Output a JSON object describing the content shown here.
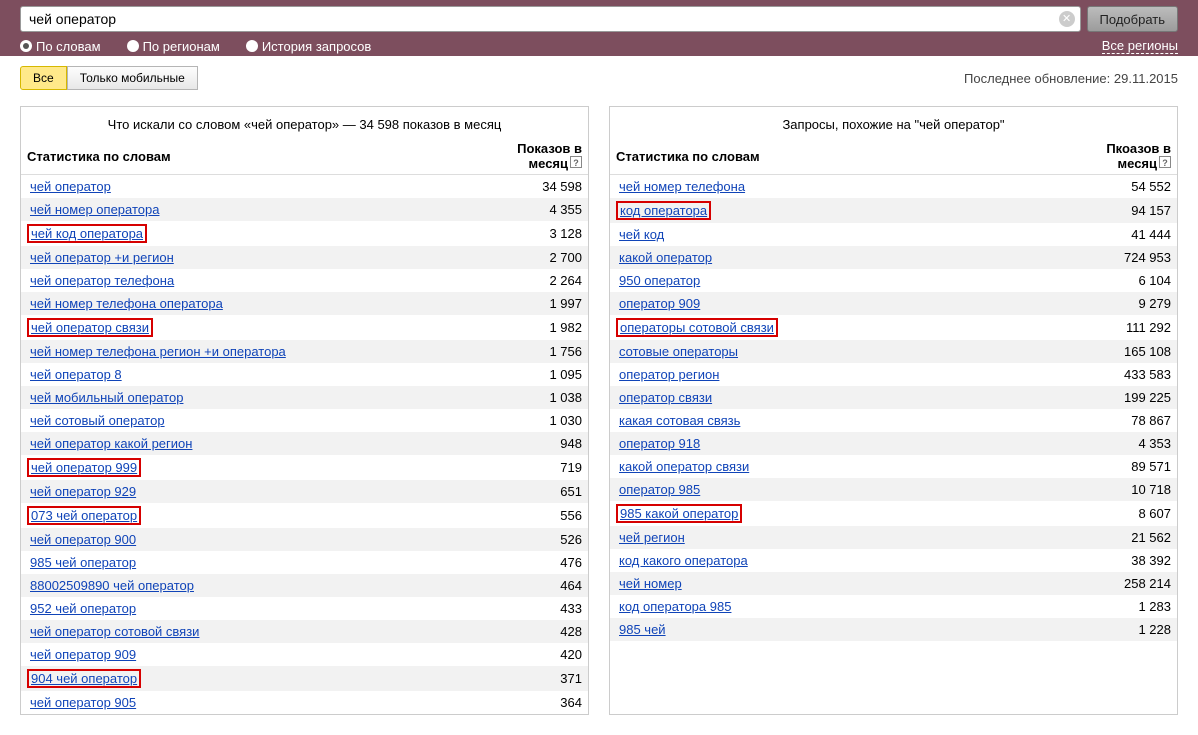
{
  "search": {
    "query": "чей оператор",
    "submit_label": "Подобрать"
  },
  "tabs_mode": {
    "by_words": "По словам",
    "by_regions": "По регионам",
    "history": "История запросов"
  },
  "region_link": "Все регионы",
  "device_tabs": {
    "all": "Все",
    "mobile": "Только мобильные"
  },
  "update_info": "Последнее обновление: 29.11.2015",
  "left_panel": {
    "title": "Что искали со словом «чей оператор» — 34 598 показов в месяц",
    "head_term": "Статистика по словам",
    "head_count": "Показов в месяц",
    "rows": [
      {
        "term": "чей оператор",
        "count": "34 598",
        "hl": false
      },
      {
        "term": "чей номер оператора",
        "count": "4 355",
        "hl": false
      },
      {
        "term": "чей код оператора",
        "count": "3 128",
        "hl": true
      },
      {
        "term": "чей оператор +и регион",
        "count": "2 700",
        "hl": false
      },
      {
        "term": "чей оператор телефона",
        "count": "2 264",
        "hl": false
      },
      {
        "term": "чей номер телефона оператора",
        "count": "1 997",
        "hl": false
      },
      {
        "term": "чей оператор связи",
        "count": "1 982",
        "hl": true
      },
      {
        "term": "чей номер телефона регион +и оператора",
        "count": "1 756",
        "hl": false
      },
      {
        "term": "чей оператор 8",
        "count": "1 095",
        "hl": false
      },
      {
        "term": "чей мобильный оператор",
        "count": "1 038",
        "hl": false
      },
      {
        "term": "чей сотовый оператор",
        "count": "1 030",
        "hl": false
      },
      {
        "term": "чей оператор какой регион",
        "count": "948",
        "hl": false
      },
      {
        "term": "чей оператор 999",
        "count": "719",
        "hl": true
      },
      {
        "term": "чей оператор 929",
        "count": "651",
        "hl": false
      },
      {
        "term": "073 чей оператор",
        "count": "556",
        "hl": true
      },
      {
        "term": "чей оператор 900",
        "count": "526",
        "hl": false
      },
      {
        "term": "985 чей оператор",
        "count": "476",
        "hl": false
      },
      {
        "term": "88002509890 чей оператор",
        "count": "464",
        "hl": false
      },
      {
        "term": "952 чей оператор",
        "count": "433",
        "hl": false
      },
      {
        "term": "чей оператор сотовой связи",
        "count": "428",
        "hl": false
      },
      {
        "term": "чей оператор 909",
        "count": "420",
        "hl": false
      },
      {
        "term": "904 чей оператор",
        "count": "371",
        "hl": true
      },
      {
        "term": "чей оператор 905",
        "count": "364",
        "hl": false
      }
    ]
  },
  "right_panel": {
    "title": "Запросы, похожие на \"чей оператор\"",
    "head_term": "Статистика по словам",
    "head_count": "Пкоазов в месяц",
    "rows": [
      {
        "term": "чей номер телефона",
        "count": "54 552",
        "hl": false
      },
      {
        "term": "код оператора",
        "count": "94 157",
        "hl": true
      },
      {
        "term": "чей код",
        "count": "41 444",
        "hl": false
      },
      {
        "term": "какой оператор",
        "count": "724 953",
        "hl": false
      },
      {
        "term": "950 оператор",
        "count": "6 104",
        "hl": false
      },
      {
        "term": "оператор 909",
        "count": "9 279",
        "hl": false
      },
      {
        "term": "операторы сотовой связи",
        "count": "111 292",
        "hl": true
      },
      {
        "term": "сотовые операторы",
        "count": "165 108",
        "hl": false
      },
      {
        "term": "оператор регион",
        "count": "433 583",
        "hl": false
      },
      {
        "term": "оператор связи",
        "count": "199 225",
        "hl": false
      },
      {
        "term": "какая сотовая связь",
        "count": "78 867",
        "hl": false
      },
      {
        "term": "оператор 918",
        "count": "4 353",
        "hl": false
      },
      {
        "term": "какой оператор связи",
        "count": "89 571",
        "hl": false
      },
      {
        "term": "оператор 985",
        "count": "10 718",
        "hl": false
      },
      {
        "term": "985 какой оператор",
        "count": "8 607",
        "hl": true
      },
      {
        "term": "чей регион",
        "count": "21 562",
        "hl": false
      },
      {
        "term": "код какого оператора",
        "count": "38 392",
        "hl": false
      },
      {
        "term": "чей номер",
        "count": "258 214",
        "hl": false
      },
      {
        "term": "код оператора 985",
        "count": "1 283",
        "hl": false
      },
      {
        "term": "985 чей",
        "count": "1 228",
        "hl": false
      }
    ]
  }
}
